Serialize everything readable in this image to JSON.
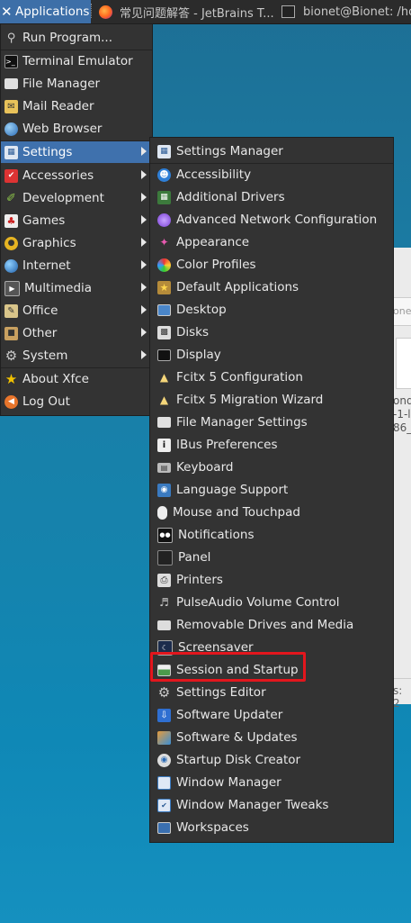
{
  "panel": {
    "applications_label": "Applications",
    "tasks": [
      {
        "label": "常见问题解答 - JetBrains T..."
      },
      {
        "label": "bionet@Bionet: /ho"
      }
    ]
  },
  "background_window": {
    "tab_fragment": "onet",
    "text_lines": [
      "ond",
      "-1-l",
      "86_"
    ],
    "footer_fragment": "s: 2"
  },
  "main_menu": {
    "items": [
      {
        "label": "Run Program...",
        "icon": "search-icon"
      },
      {
        "label": "Terminal Emulator",
        "icon": "terminal-icon"
      },
      {
        "label": "File Manager",
        "icon": "folder-icon"
      },
      {
        "label": "Mail Reader",
        "icon": "mail-icon"
      },
      {
        "label": "Web Browser",
        "icon": "globe-icon"
      },
      {
        "label": "Settings",
        "icon": "settings-icon",
        "active": true,
        "submenu": true
      },
      {
        "label": "Accessories",
        "icon": "accessories-icon",
        "submenu": true
      },
      {
        "label": "Development",
        "icon": "development-icon",
        "submenu": true
      },
      {
        "label": "Games",
        "icon": "games-icon",
        "submenu": true
      },
      {
        "label": "Graphics",
        "icon": "graphics-icon",
        "submenu": true
      },
      {
        "label": "Internet",
        "icon": "internet-icon",
        "submenu": true
      },
      {
        "label": "Multimedia",
        "icon": "multimedia-icon",
        "submenu": true
      },
      {
        "label": "Office",
        "icon": "office-icon",
        "submenu": true
      },
      {
        "label": "Other",
        "icon": "other-icon",
        "submenu": true
      },
      {
        "label": "System",
        "icon": "system-icon",
        "submenu": true
      },
      {
        "label": "About Xfce",
        "icon": "star-icon"
      },
      {
        "label": "Log Out",
        "icon": "logout-icon"
      }
    ]
  },
  "settings_menu": {
    "items": [
      {
        "label": "Settings Manager",
        "icon": "settings-manager-icon"
      },
      {
        "label": "Accessibility",
        "icon": "accessibility-icon"
      },
      {
        "label": "Additional Drivers",
        "icon": "chip-icon"
      },
      {
        "label": "Advanced Network Configuration",
        "icon": "network-icon"
      },
      {
        "label": "Appearance",
        "icon": "appearance-icon"
      },
      {
        "label": "Color Profiles",
        "icon": "color-profiles-icon"
      },
      {
        "label": "Default Applications",
        "icon": "star-icon"
      },
      {
        "label": "Desktop",
        "icon": "desktop-icon"
      },
      {
        "label": "Disks",
        "icon": "disk-icon"
      },
      {
        "label": "Display",
        "icon": "display-icon"
      },
      {
        "label": "Fcitx 5 Configuration",
        "icon": "penguin-icon"
      },
      {
        "label": "Fcitx 5 Migration Wizard",
        "icon": "penguin-icon"
      },
      {
        "label": "File Manager Settings",
        "icon": "folder-icon"
      },
      {
        "label": "IBus Preferences",
        "icon": "info-icon"
      },
      {
        "label": "Keyboard",
        "icon": "keyboard-icon"
      },
      {
        "label": "Language Support",
        "icon": "language-icon"
      },
      {
        "label": "Mouse and Touchpad",
        "icon": "mouse-icon"
      },
      {
        "label": "Notifications",
        "icon": "notifications-icon"
      },
      {
        "label": "Panel",
        "icon": "panel-icon"
      },
      {
        "label": "Printers",
        "icon": "printer-icon"
      },
      {
        "label": "PulseAudio Volume Control",
        "icon": "speaker-icon"
      },
      {
        "label": "Removable Drives and Media",
        "icon": "drive-icon"
      },
      {
        "label": "Screensaver",
        "icon": "screensaver-icon"
      },
      {
        "label": "Session and Startup",
        "icon": "session-icon",
        "highlighted": true
      },
      {
        "label": "Settings Editor",
        "icon": "gear-icon"
      },
      {
        "label": "Software Updater",
        "icon": "updater-icon"
      },
      {
        "label": "Software & Updates",
        "icon": "software-icon"
      },
      {
        "label": "Startup Disk Creator",
        "icon": "startup-disk-icon"
      },
      {
        "label": "Window Manager",
        "icon": "window-manager-icon"
      },
      {
        "label": "Window Manager Tweaks",
        "icon": "window-tweaks-icon"
      },
      {
        "label": "Workspaces",
        "icon": "workspaces-icon"
      }
    ]
  },
  "colors": {
    "panel_bg": "#2b2b2b",
    "menu_bg": "#333333",
    "selection": "#3f71ad",
    "annotation_red": "#e3161d"
  }
}
